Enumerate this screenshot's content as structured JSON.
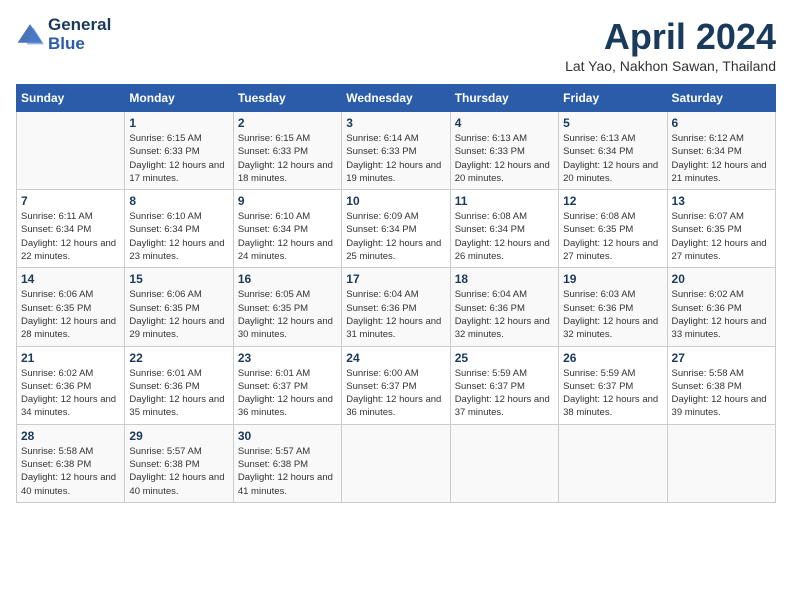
{
  "header": {
    "logo_line1": "General",
    "logo_line2": "Blue",
    "month": "April 2024",
    "location": "Lat Yao, Nakhon Sawan, Thailand"
  },
  "days_of_week": [
    "Sunday",
    "Monday",
    "Tuesday",
    "Wednesday",
    "Thursday",
    "Friday",
    "Saturday"
  ],
  "weeks": [
    [
      {
        "day": "",
        "sunrise": "",
        "sunset": "",
        "daylight": ""
      },
      {
        "day": "1",
        "sunrise": "Sunrise: 6:15 AM",
        "sunset": "Sunset: 6:33 PM",
        "daylight": "Daylight: 12 hours and 17 minutes."
      },
      {
        "day": "2",
        "sunrise": "Sunrise: 6:15 AM",
        "sunset": "Sunset: 6:33 PM",
        "daylight": "Daylight: 12 hours and 18 minutes."
      },
      {
        "day": "3",
        "sunrise": "Sunrise: 6:14 AM",
        "sunset": "Sunset: 6:33 PM",
        "daylight": "Daylight: 12 hours and 19 minutes."
      },
      {
        "day": "4",
        "sunrise": "Sunrise: 6:13 AM",
        "sunset": "Sunset: 6:33 PM",
        "daylight": "Daylight: 12 hours and 20 minutes."
      },
      {
        "day": "5",
        "sunrise": "Sunrise: 6:13 AM",
        "sunset": "Sunset: 6:34 PM",
        "daylight": "Daylight: 12 hours and 20 minutes."
      },
      {
        "day": "6",
        "sunrise": "Sunrise: 6:12 AM",
        "sunset": "Sunset: 6:34 PM",
        "daylight": "Daylight: 12 hours and 21 minutes."
      }
    ],
    [
      {
        "day": "7",
        "sunrise": "Sunrise: 6:11 AM",
        "sunset": "Sunset: 6:34 PM",
        "daylight": "Daylight: 12 hours and 22 minutes."
      },
      {
        "day": "8",
        "sunrise": "Sunrise: 6:10 AM",
        "sunset": "Sunset: 6:34 PM",
        "daylight": "Daylight: 12 hours and 23 minutes."
      },
      {
        "day": "9",
        "sunrise": "Sunrise: 6:10 AM",
        "sunset": "Sunset: 6:34 PM",
        "daylight": "Daylight: 12 hours and 24 minutes."
      },
      {
        "day": "10",
        "sunrise": "Sunrise: 6:09 AM",
        "sunset": "Sunset: 6:34 PM",
        "daylight": "Daylight: 12 hours and 25 minutes."
      },
      {
        "day": "11",
        "sunrise": "Sunrise: 6:08 AM",
        "sunset": "Sunset: 6:34 PM",
        "daylight": "Daylight: 12 hours and 26 minutes."
      },
      {
        "day": "12",
        "sunrise": "Sunrise: 6:08 AM",
        "sunset": "Sunset: 6:35 PM",
        "daylight": "Daylight: 12 hours and 27 minutes."
      },
      {
        "day": "13",
        "sunrise": "Sunrise: 6:07 AM",
        "sunset": "Sunset: 6:35 PM",
        "daylight": "Daylight: 12 hours and 27 minutes."
      }
    ],
    [
      {
        "day": "14",
        "sunrise": "Sunrise: 6:06 AM",
        "sunset": "Sunset: 6:35 PM",
        "daylight": "Daylight: 12 hours and 28 minutes."
      },
      {
        "day": "15",
        "sunrise": "Sunrise: 6:06 AM",
        "sunset": "Sunset: 6:35 PM",
        "daylight": "Daylight: 12 hours and 29 minutes."
      },
      {
        "day": "16",
        "sunrise": "Sunrise: 6:05 AM",
        "sunset": "Sunset: 6:35 PM",
        "daylight": "Daylight: 12 hours and 30 minutes."
      },
      {
        "day": "17",
        "sunrise": "Sunrise: 6:04 AM",
        "sunset": "Sunset: 6:36 PM",
        "daylight": "Daylight: 12 hours and 31 minutes."
      },
      {
        "day": "18",
        "sunrise": "Sunrise: 6:04 AM",
        "sunset": "Sunset: 6:36 PM",
        "daylight": "Daylight: 12 hours and 32 minutes."
      },
      {
        "day": "19",
        "sunrise": "Sunrise: 6:03 AM",
        "sunset": "Sunset: 6:36 PM",
        "daylight": "Daylight: 12 hours and 32 minutes."
      },
      {
        "day": "20",
        "sunrise": "Sunrise: 6:02 AM",
        "sunset": "Sunset: 6:36 PM",
        "daylight": "Daylight: 12 hours and 33 minutes."
      }
    ],
    [
      {
        "day": "21",
        "sunrise": "Sunrise: 6:02 AM",
        "sunset": "Sunset: 6:36 PM",
        "daylight": "Daylight: 12 hours and 34 minutes."
      },
      {
        "day": "22",
        "sunrise": "Sunrise: 6:01 AM",
        "sunset": "Sunset: 6:36 PM",
        "daylight": "Daylight: 12 hours and 35 minutes."
      },
      {
        "day": "23",
        "sunrise": "Sunrise: 6:01 AM",
        "sunset": "Sunset: 6:37 PM",
        "daylight": "Daylight: 12 hours and 36 minutes."
      },
      {
        "day": "24",
        "sunrise": "Sunrise: 6:00 AM",
        "sunset": "Sunset: 6:37 PM",
        "daylight": "Daylight: 12 hours and 36 minutes."
      },
      {
        "day": "25",
        "sunrise": "Sunrise: 5:59 AM",
        "sunset": "Sunset: 6:37 PM",
        "daylight": "Daylight: 12 hours and 37 minutes."
      },
      {
        "day": "26",
        "sunrise": "Sunrise: 5:59 AM",
        "sunset": "Sunset: 6:37 PM",
        "daylight": "Daylight: 12 hours and 38 minutes."
      },
      {
        "day": "27",
        "sunrise": "Sunrise: 5:58 AM",
        "sunset": "Sunset: 6:38 PM",
        "daylight": "Daylight: 12 hours and 39 minutes."
      }
    ],
    [
      {
        "day": "28",
        "sunrise": "Sunrise: 5:58 AM",
        "sunset": "Sunset: 6:38 PM",
        "daylight": "Daylight: 12 hours and 40 minutes."
      },
      {
        "day": "29",
        "sunrise": "Sunrise: 5:57 AM",
        "sunset": "Sunset: 6:38 PM",
        "daylight": "Daylight: 12 hours and 40 minutes."
      },
      {
        "day": "30",
        "sunrise": "Sunrise: 5:57 AM",
        "sunset": "Sunset: 6:38 PM",
        "daylight": "Daylight: 12 hours and 41 minutes."
      },
      {
        "day": "",
        "sunrise": "",
        "sunset": "",
        "daylight": ""
      },
      {
        "day": "",
        "sunrise": "",
        "sunset": "",
        "daylight": ""
      },
      {
        "day": "",
        "sunrise": "",
        "sunset": "",
        "daylight": ""
      },
      {
        "day": "",
        "sunrise": "",
        "sunset": "",
        "daylight": ""
      }
    ]
  ]
}
